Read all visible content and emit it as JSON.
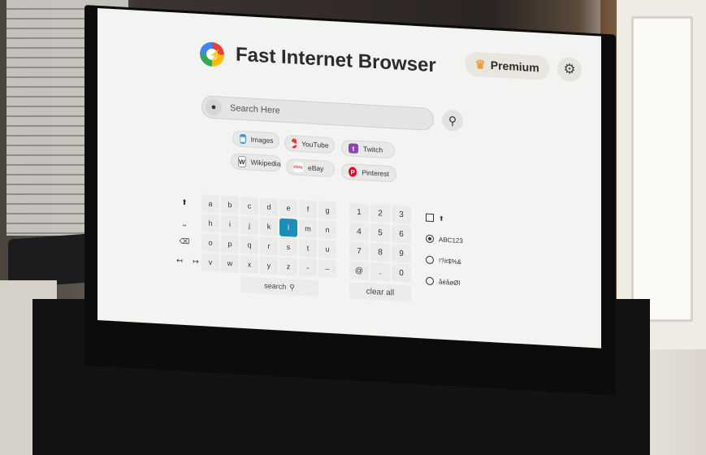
{
  "app": {
    "title": "Fast Internet Browser"
  },
  "header": {
    "premium_label": "Premium"
  },
  "search": {
    "placeholder": "Search Here"
  },
  "quick_links": [
    {
      "label": "Images"
    },
    {
      "label": "YouTube"
    },
    {
      "label": "Twitch"
    },
    {
      "label": "Wikipedia"
    },
    {
      "label": "eBay"
    },
    {
      "label": "Pinterest"
    }
  ],
  "keyboard": {
    "letters": [
      "a",
      "b",
      "c",
      "d",
      "e",
      "f",
      "g",
      "h",
      "i",
      "j",
      "k",
      "l",
      "m",
      "n",
      "o",
      "p",
      "q",
      "r",
      "s",
      "t",
      "u",
      "v",
      "w",
      "x",
      "y",
      "z",
      "-",
      "–"
    ],
    "digits": [
      "1",
      "2",
      "3",
      "4",
      "5",
      "6",
      "7",
      "8",
      "9",
      "@",
      ".",
      "0"
    ],
    "search_label": "search",
    "clear_label": "clear all",
    "modes": [
      "ABC123",
      "!?#$%&",
      "åéåøØl"
    ],
    "selected_key": "l",
    "selected_mode": "ABC123"
  },
  "colors": {
    "accent": "#1b8fb6",
    "premium_crown": "#e6a23c"
  }
}
